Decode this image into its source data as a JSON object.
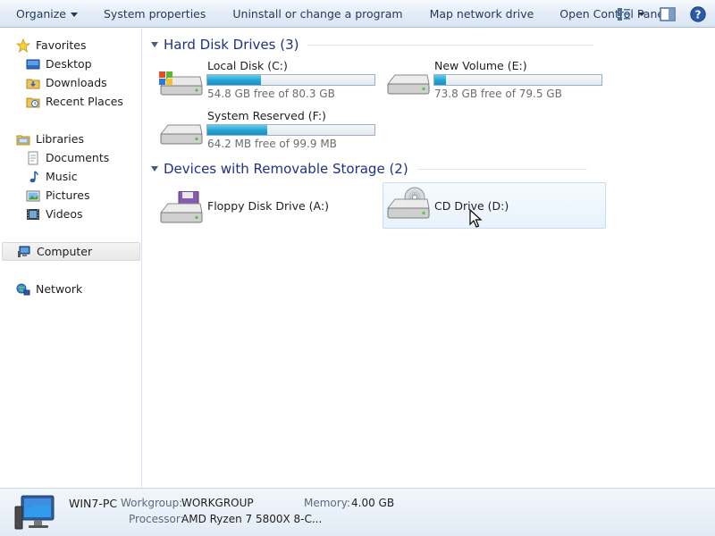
{
  "toolbar": {
    "organize": "Organize",
    "system_properties": "System properties",
    "uninstall": "Uninstall or change a program",
    "map_drive": "Map network drive",
    "control_panel": "Open Control Panel",
    "icons": [
      "view-options-icon",
      "preview-pane-icon",
      "help-icon"
    ]
  },
  "sidebar": {
    "favorites": "Favorites",
    "desktop": "Desktop",
    "downloads": "Downloads",
    "recent": "Recent Places",
    "libraries": "Libraries",
    "documents": "Documents",
    "music": "Music",
    "pictures": "Pictures",
    "videos": "Videos",
    "computer": "Computer",
    "network": "Network"
  },
  "groups": {
    "hdd": "Hard Disk Drives (3)",
    "removable": "Devices with Removable Storage (2)"
  },
  "drives": {
    "c": {
      "name": "Local Disk (C:)",
      "free": "54.8 GB free of 80.3 GB",
      "used_fraction": 0.32
    },
    "e": {
      "name": "New Volume (E:)",
      "free": "73.8 GB free of 79.5 GB",
      "used_fraction": 0.07
    },
    "f": {
      "name": "System Reserved (F:)",
      "free": "64.2 MB free of 99.9 MB",
      "used_fraction": 0.36
    },
    "a": {
      "name": "Floppy Disk Drive (A:)"
    },
    "d": {
      "name": "CD Drive (D:)"
    }
  },
  "details": {
    "computer_name": "WIN7-PC",
    "workgroup_label": "Workgroup:",
    "workgroup": "WORKGROUP",
    "memory_label": "Memory:",
    "memory": "4.00 GB",
    "processor_label": "Processor:",
    "processor": "AMD Ryzen 7 5800X 8-C..."
  },
  "colors": {
    "header_text": "#1e3287",
    "bar_fill": "#27a3d4",
    "toolbar_text": "#1e395b"
  }
}
